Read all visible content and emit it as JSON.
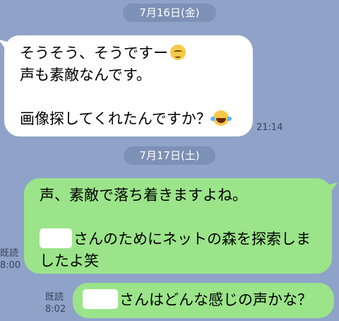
{
  "dates": [
    "7月16日(金)",
    "7月17日(土)"
  ],
  "messages": {
    "incoming": {
      "line1": "そうそう、そうですー",
      "line2": "声も素敵なんです。",
      "line3": "画像探してくれたんですか？",
      "time": "21:14",
      "emoji1": "relieved-face",
      "emoji2": "face-with-tears-of-joy"
    },
    "outgoing1": {
      "line1": "声、素敵で落ち着きますよね。",
      "line2": "さんのためにネットの森を探索しま",
      "line3": "したよ笑",
      "read": "既読",
      "time": "8:00"
    },
    "outgoing2": {
      "line1": "さんはどんな感じの声かな？",
      "read": "既読",
      "time": "8:02"
    }
  },
  "colors": {
    "background": "#8fa3c9",
    "incoming_bubble": "#ffffff",
    "outgoing_bubble": "#9be489"
  }
}
